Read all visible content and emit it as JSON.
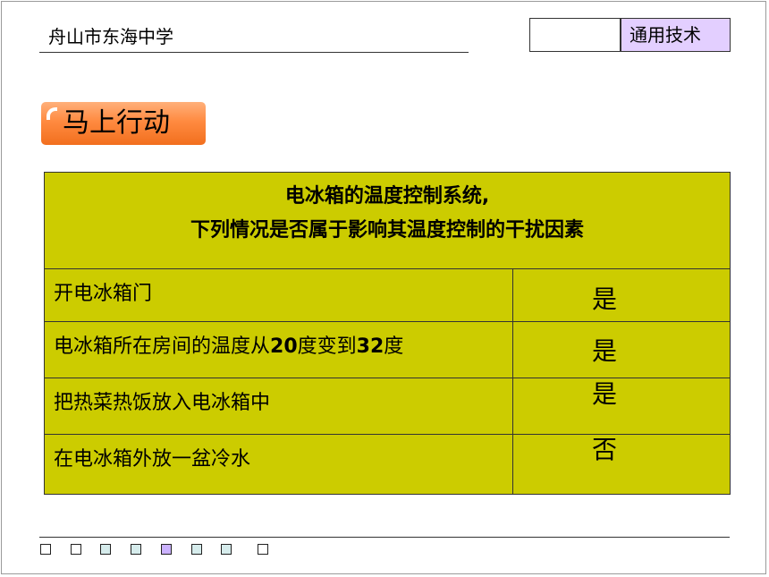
{
  "header": {
    "school": "舟山市东海中学",
    "subject": "通用技术"
  },
  "badge": {
    "label": "马上行动"
  },
  "table": {
    "question_line1": "电冰箱的温度控制系统,",
    "question_line2": "下列情况是否属于影响其温度控制的干扰因素",
    "rows": [
      {
        "label": "开电冰箱门"
      },
      {
        "label_parts": [
          "电冰箱所在房间的温度从",
          "20",
          "度变到",
          "32",
          "度"
        ]
      },
      {
        "label": "把热菜热饭放入电冰箱中"
      },
      {
        "label": "在电冰箱外放一盆冷水"
      }
    ],
    "answers": [
      "是",
      "是",
      "是",
      "否"
    ]
  },
  "footer": {
    "nav_squares": [
      {
        "icon": "empty-square-icon",
        "color": "#ffffff"
      },
      {
        "icon": "empty-square-icon",
        "color": "#ffffff"
      },
      {
        "icon": "square-icon",
        "color": "#d6ecec"
      },
      {
        "icon": "square-icon",
        "color": "#d6ecec"
      },
      {
        "icon": "square-icon",
        "color": "#cbb2ff"
      },
      {
        "icon": "square-icon",
        "color": "#d6ecec"
      },
      {
        "icon": "square-icon",
        "color": "#d6ecec"
      },
      {
        "icon": "empty-square-icon",
        "color": "#ffffff"
      }
    ]
  },
  "colors": {
    "table_bg": "#cccc00",
    "badge_orange": "#f7812e",
    "subject_bg": "#e3cfff"
  }
}
